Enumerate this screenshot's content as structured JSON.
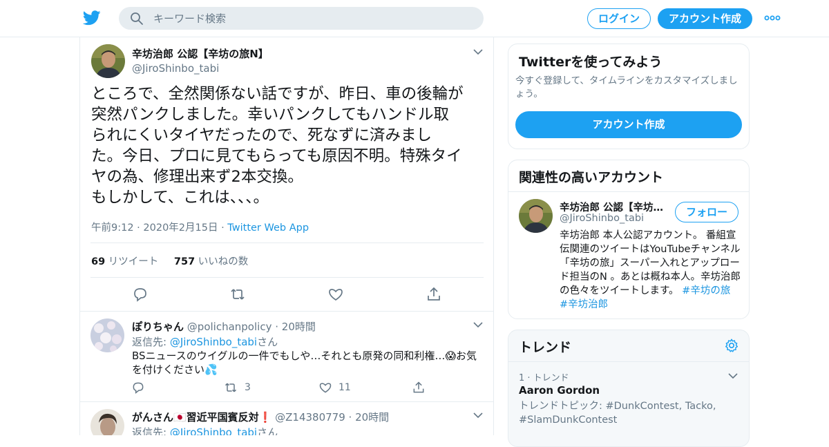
{
  "header": {
    "search_placeholder": "キーワード検索",
    "login_label": "ログイン",
    "signup_label": "アカウント作成"
  },
  "tweet": {
    "name": "辛坊治郎 公認【辛坊の旅N】",
    "handle": "@JiroShinbo_tabi",
    "text": "ところで、全然関係ない話ですが、昨日、車の後輪が\n突然パンクしました。幸いパンクしてもハンドル取\nられにくいタイヤだったので、死なずに済みまし\nた。今日、プロに見てもらっても原因不明。特殊タイ\nヤの為、修理出来ず2本交換。\nもしかして、これは、、、。",
    "time": "午前9:12 · 2020年2月15日 · ",
    "source": "Twitter Web App",
    "retweet_count": "69",
    "retweet_label": " リツイート",
    "like_count": "757",
    "like_label": " いいねの数"
  },
  "replies": [
    {
      "name": "ぽりちゃん",
      "handle": "@polichanpolicy",
      "time": "· 20時間",
      "to_prefix": "返信先: ",
      "to_handle": "@JiroShinbo_tabi",
      "to_suffix": "さん",
      "text": "BSニュースのウイグルの一件でもしや…それとも原発の同和利権…😱お気を付けください💦",
      "retweets": "3",
      "likes": "11"
    },
    {
      "name": "がんさん🇯🇵習近平国賓反対❗",
      "handle": "@Z14380779",
      "time": "· 20時間",
      "to_prefix": "返信先: ",
      "to_handle": "@JiroShinbo_tabi",
      "to_suffix": "さん"
    }
  ],
  "signup_card": {
    "title": "Twitterを使ってみよう",
    "text": "今すぐ登録して、タイムラインをカスタマイズしましょう。",
    "button": "アカウント作成"
  },
  "related_card": {
    "title": "関連性の高いアカウント",
    "name": "辛坊治郎 公認【辛坊…",
    "handle": "@JiroShinbo_tabi",
    "follow_label": "フォロー",
    "bio": "辛坊治郎 本人公認アカウント。 番組宣伝関連のツイートはYouTubeチャンネル「辛坊の旅」スーパー入れとアップロード担当のN 。あとは概ね本人。辛坊治郎の色々をツイートします。 ",
    "hashtags": "#辛坊の旅 #辛坊治郎"
  },
  "trends_card": {
    "title": "トレンド",
    "rank": "1 · トレンド",
    "trend_name": "Aaron Gordon",
    "trend_sub": "トレンドトピック: #DunkContest, Tacko, #SlamDunkContest"
  },
  "colors": {
    "accent": "#1da1f2",
    "link": "#1b95e0",
    "muted": "#657786",
    "border": "#e6ecf0"
  }
}
